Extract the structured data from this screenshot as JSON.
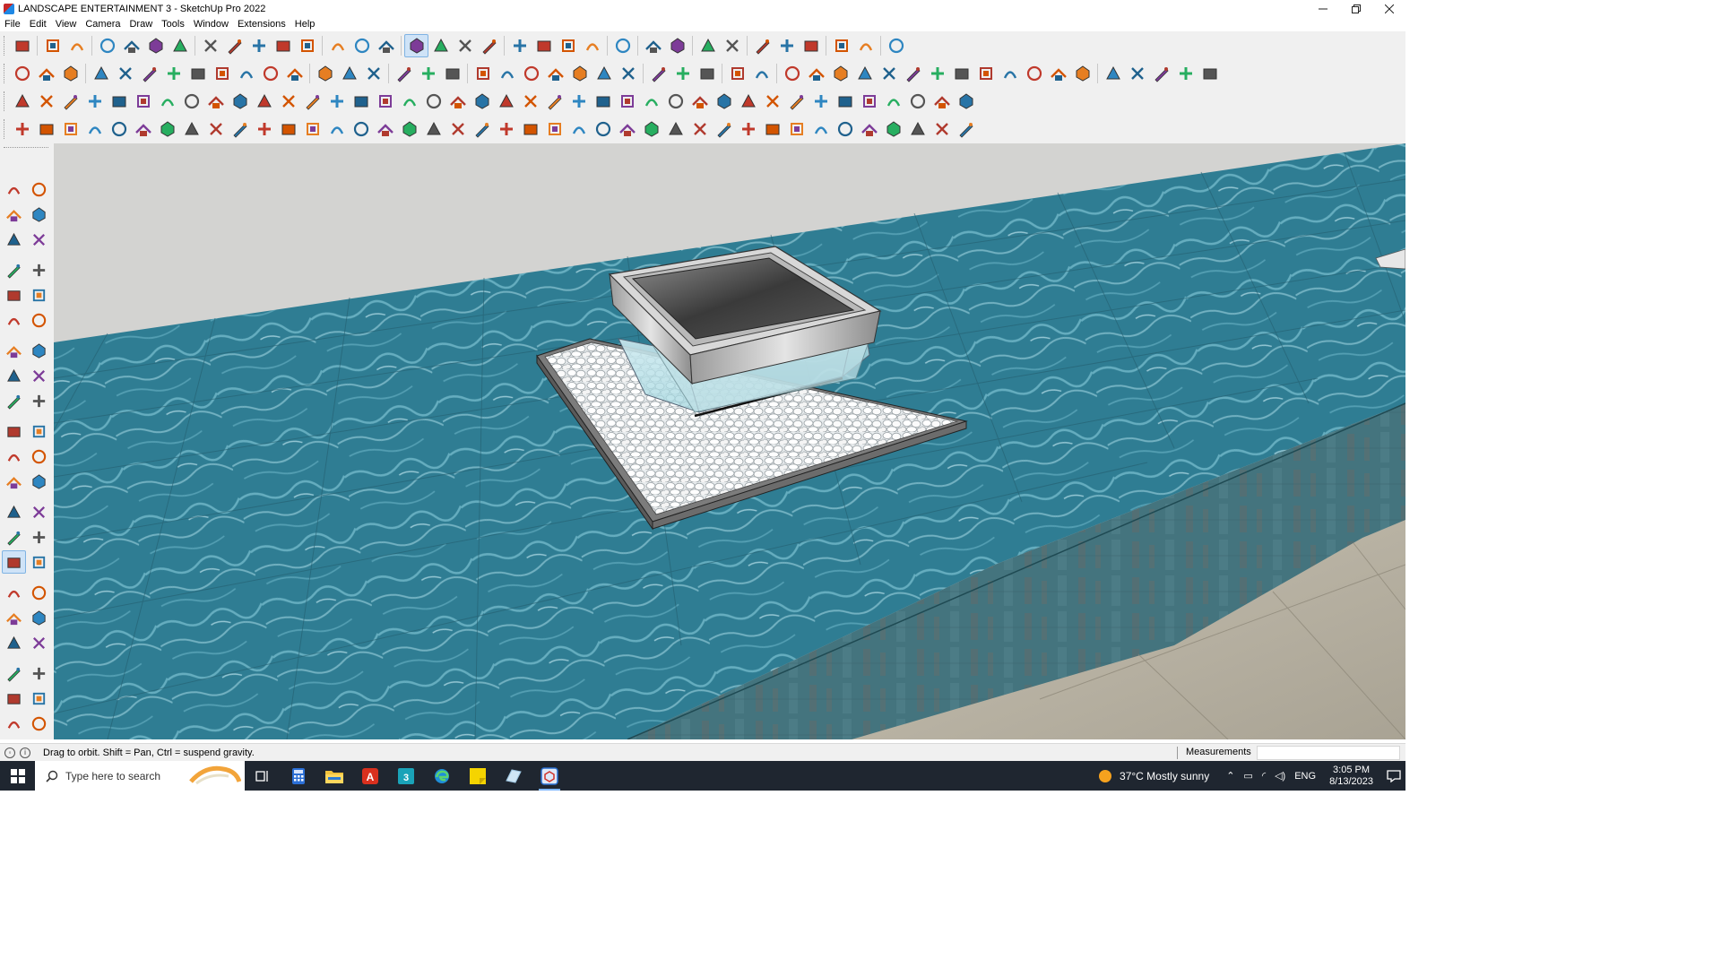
{
  "window": {
    "title": "LANDSCAPE ENTERTAINMENT 3 - SketchUp Pro 2022",
    "controls": [
      "minimize",
      "restore",
      "close"
    ]
  },
  "menu": [
    "File",
    "Edit",
    "View",
    "Camera",
    "Draw",
    "Tools",
    "Window",
    "Extensions",
    "Help"
  ],
  "toolbars": {
    "row1": [
      "zoom-icon",
      "select-icon",
      "paint-icon",
      "eraser-icon",
      "pencil-icon",
      "arc-icon",
      "rectangle-icon",
      "push-pull-icon",
      "follow-me-icon",
      "move-icon",
      "rotate-icon",
      "scale-icon",
      "tape-icon",
      "text-icon",
      "paint-bucket-icon",
      "orbit-icon",
      "pan-icon",
      "zoom-tool-icon",
      "zoom-extents-icon",
      "components-icon",
      "layers-icon",
      "styles-icon",
      "shadows-icon",
      "user-icon",
      "section-icon",
      "section-cut-icon",
      "axes-icon",
      "flip-icon",
      "intersect-icon",
      "warehouse-icon",
      "extension-icon",
      "undo-icon",
      "redo-icon",
      "outer-shell-icon"
    ],
    "row2_count": 48,
    "row3_count": 40,
    "row4_count": 40
  },
  "left_toolbar": {
    "active": "orbit-tool"
  },
  "viewport": {
    "sky_color": "#d4d4d2",
    "water_color": "#3a8aa0",
    "wall_color": "#4f7f8a",
    "paving_color": "#bdb7a8"
  },
  "status": {
    "hint": "Drag to orbit. Shift = Pan, Ctrl = suspend gravity.",
    "measurements_label": "Measurements",
    "measurements_value": ""
  },
  "taskbar": {
    "search_placeholder": "Type here to search",
    "apps": [
      "task-view-icon",
      "calculator-icon",
      "file-explorer-icon",
      "acrobat-icon",
      "3dsmax-icon",
      "edge-icon",
      "sticky-notes-icon",
      "maps-icon",
      "sketchup-icon"
    ],
    "active_app": "sketchup-icon",
    "weather": "37°C  Mostly sunny",
    "language": "ENG",
    "time": "3:05 PM",
    "date": "8/13/2023"
  }
}
